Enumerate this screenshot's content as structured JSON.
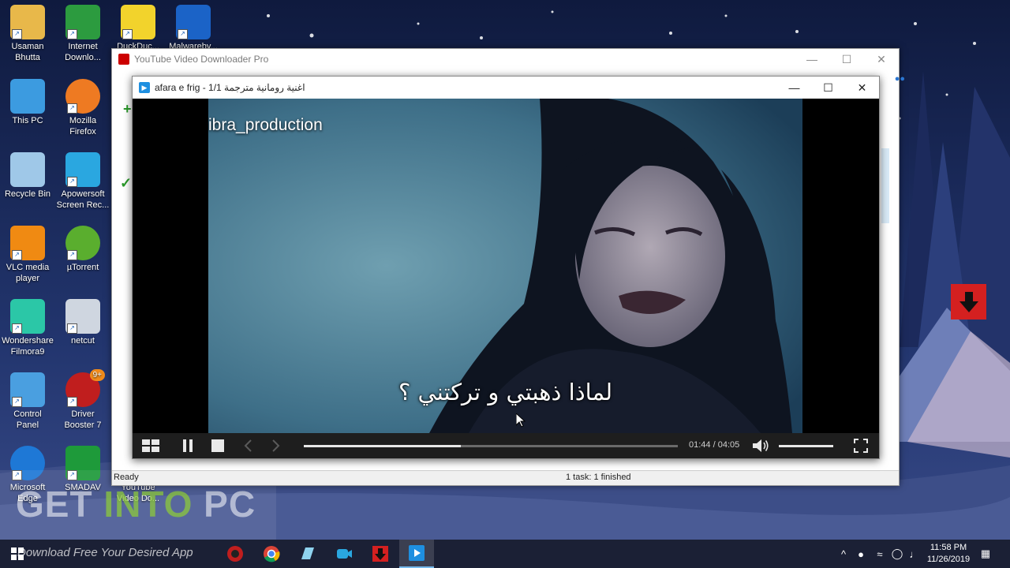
{
  "desktop": {
    "icons": [
      {
        "label": "Usaman\nBhutta",
        "icon": "user-folder-icon"
      },
      {
        "label": "Internet\nDownlo...",
        "icon": "internet-download-manager-icon"
      },
      {
        "label": "DuckDuc...",
        "icon": "duck-icon"
      },
      {
        "label": "Malwareby...",
        "icon": "malwarebytes-icon"
      },
      {
        "label": "This PC",
        "icon": "computer-icon"
      },
      {
        "label": "Mozilla\nFirefox",
        "icon": "firefox-icon"
      },
      {
        "label": "Recycle Bin",
        "icon": "recycle-bin-icon"
      },
      {
        "label": "Apowersoft\nScreen Rec...",
        "icon": "camera-icon"
      },
      {
        "label": "VLC media\nplayer",
        "icon": "vlc-cone-icon"
      },
      {
        "label": "µTorrent",
        "icon": "utorrent-icon"
      },
      {
        "label": "Wondershare\nFilmora9",
        "icon": "filmora-icon"
      },
      {
        "label": "netcut",
        "icon": "scissors-icon"
      },
      {
        "label": "Control\nPanel",
        "icon": "control-panel-icon"
      },
      {
        "label": "Driver\nBooster 7",
        "icon": "driver-booster-icon"
      },
      {
        "label": "Microsoft\nEdge",
        "icon": "edge-icon"
      },
      {
        "label": "SMADAV",
        "icon": "smadav-icon"
      },
      {
        "label": "YouTube\nVideo Do...",
        "icon": "youtube-downloader-icon"
      }
    ],
    "driver_booster_badge": "9+"
  },
  "watermark": {
    "text_get": "GET ",
    "text_into": "INTO",
    "text_pc": " PC",
    "tagline": "Download Free Your Desired App"
  },
  "app_window": {
    "title": "YouTube Video Downloader Pro",
    "status_left": "Ready",
    "status_center": "1 task: 1 finished"
  },
  "player": {
    "title": "اغنية رومانية مترجمة afara e frig - 1/1",
    "channel_watermark": "ibra_production",
    "subtitle": "لماذا ذهبتي و تركتني ؟",
    "time_current": "01:44",
    "time_total": "04:05",
    "progress_fraction": 0.42,
    "volume_fraction": 1.0
  },
  "taskbar": {
    "clock_time": "11:58 PM",
    "clock_date": "11/26/2019"
  },
  "colors": {
    "accent_red": "#d42020",
    "player_blue": "#1e8fe0"
  }
}
